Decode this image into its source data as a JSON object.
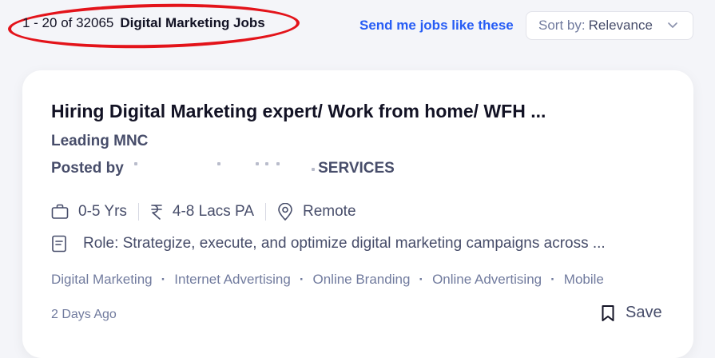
{
  "results_header": {
    "range": "1 - 20 of 32065",
    "query": "Digital Marketing Jobs"
  },
  "alert_link": "Send me jobs like these",
  "sort": {
    "label": "Sort by:",
    "value": "Relevance"
  },
  "job": {
    "title": "Hiring Digital Marketing expert/ Work from home/ WFH ...",
    "company": "Leading MNC",
    "posted_by_label": "Posted by",
    "poster_name_visible": "SERVICES",
    "experience": "0-5 Yrs",
    "salary": "4-8 Lacs PA",
    "location": "Remote",
    "description": "Role: Strategize, execute, and optimize digital marketing campaigns across ...",
    "tags": [
      "Digital Marketing",
      "Internet Advertising",
      "Online Branding",
      "Online Advertising",
      "Mobile"
    ],
    "posted_ago": "2 Days Ago",
    "save_label": "Save"
  },
  "icons": {
    "experience": "briefcase-icon",
    "salary": "rupee-icon",
    "location": "location-pin-icon",
    "description": "document-icon",
    "save": "bookmark-icon",
    "sort": "chevron-down-icon"
  },
  "colors": {
    "accent": "#275df5",
    "highlight": "#e3131a",
    "background": "#f4f5f9",
    "text_primary": "#121224",
    "text_secondary": "#474d6a",
    "text_muted": "#717b9e"
  }
}
